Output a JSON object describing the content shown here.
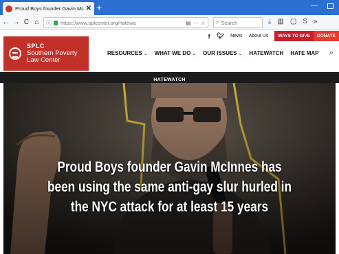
{
  "browser": {
    "tab_title": "Proud Boys founder Gavin McI",
    "new_tab_symbol": "+",
    "url": "https://www.splcenter.org/hatewa",
    "search_placeholder": "Search",
    "accent": "#2b6fd1"
  },
  "site": {
    "top_links": {
      "news": "News",
      "about": "About Us",
      "ways_to_give": "WAYS TO GIVE",
      "donate": "DONATE"
    },
    "logo": {
      "abbr": "SPLC",
      "line1": "Southern Poverty",
      "line2": "Law Center",
      "color": "#c2302a"
    },
    "nav": [
      {
        "label": "RESOURCES",
        "dropdown": true
      },
      {
        "label": "WHAT WE DO",
        "dropdown": true
      },
      {
        "label": "OUR ISSUES",
        "dropdown": true
      },
      {
        "label": "HATEWATCH",
        "dropdown": false
      },
      {
        "label": "HATE MAP",
        "dropdown": false
      }
    ],
    "section_label": "HATEWATCH"
  },
  "hero": {
    "headline": "Proud Boys founder Gavin McInnes has been using the same anti-gay slur hurled in the NYC attack for at least 15 years"
  },
  "icons": [
    "back-icon",
    "forward-icon",
    "reload-icon",
    "home-icon",
    "info-icon",
    "lock-icon",
    "page-actions-icon",
    "bookmark-star-icon",
    "search-icon",
    "download-icon",
    "library-icon",
    "sidebar-icon",
    "extension-icon",
    "overflow-icon",
    "facebook-icon",
    "twitter-icon",
    "site-search-icon"
  ]
}
